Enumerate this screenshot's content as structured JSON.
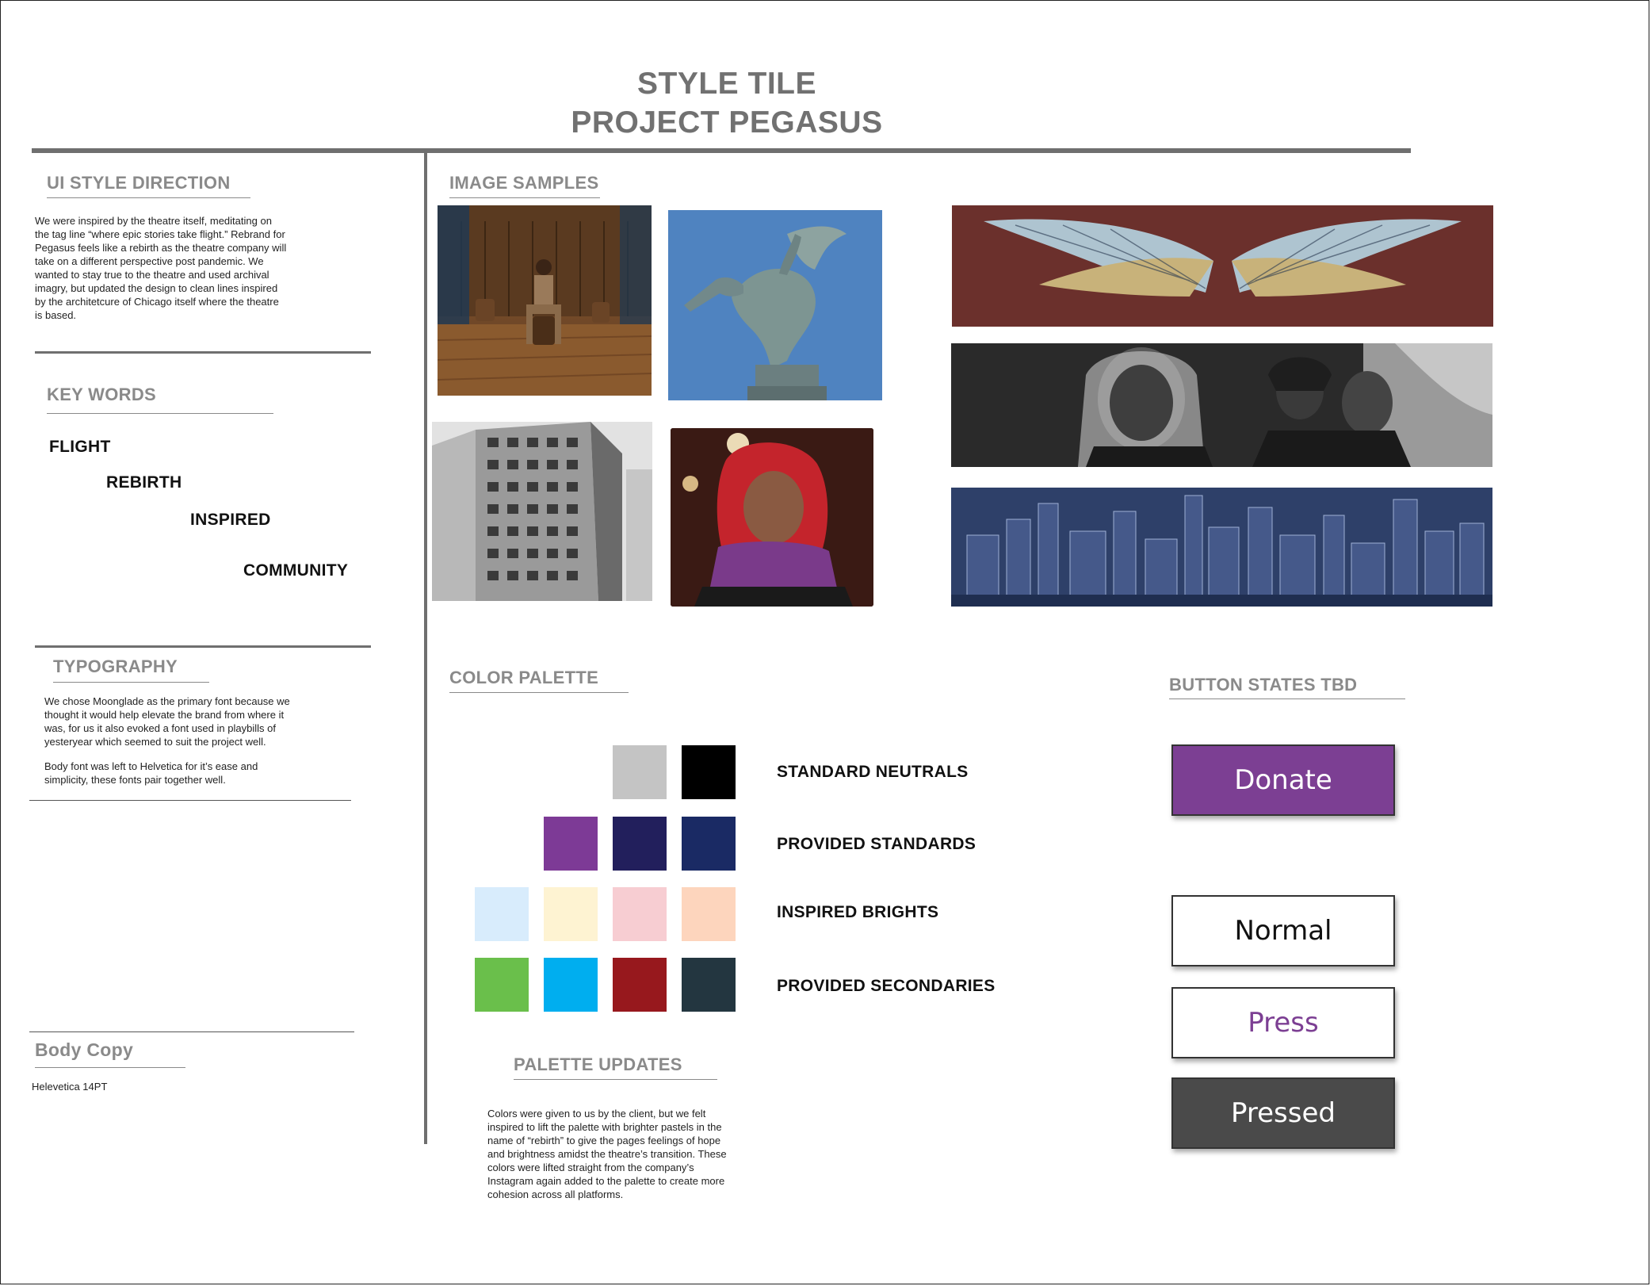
{
  "header": {
    "title_line1": "STYLE TILE",
    "title_line2": "PROJECT PEGASUS"
  },
  "ui_style_direction": {
    "heading": "UI STYLE DIRECTION",
    "lines": [
      "We were inspired by the theatre itself, meditating on",
      "the tag line “where epic stories take flight.” Rebrand for",
      "Pegasus feels like a rebirth as the theatre company will",
      "take on a different perspective post pandemic. We",
      "wanted to stay true to the theatre and used archival",
      "imagry, but updated the design to clean lines inspired",
      "by the architetcure of Chicago itself where the theatre",
      "is based."
    ]
  },
  "key_words": {
    "heading": "KEY WORDS",
    "words": [
      "FLIGHT",
      "REBIRTH",
      "INSPIRED",
      "COMMUNITY"
    ]
  },
  "typography": {
    "heading": "TYPOGRAPHY",
    "para1": [
      "We chose Moonglade as the primary font because we",
      "thought it would help elevate the brand from where it",
      "was, for us it also evoked a font used in playbills of",
      "yesteryear which seemed to suit the project well."
    ],
    "para2": [
      "Body font was left to Helvetica for it’s ease and",
      "simplicity, these fonts pair together well."
    ]
  },
  "body_copy": {
    "heading": "Body Copy",
    "sample": "Helevetica 14PT"
  },
  "image_samples": {
    "heading": "IMAGE SAMPLES"
  },
  "color_palette": {
    "heading": "COLOR PALETTE",
    "rows": [
      {
        "label": "STANDARD NEUTRALS",
        "colors": [
          "#c4c4c4",
          "#000000"
        ]
      },
      {
        "label": "PROVIDED STANDARDS",
        "colors": [
          "#7d3a96",
          "#221f5c",
          "#1a2a64"
        ]
      },
      {
        "label": "INSPIRED BRIGHTS",
        "colors": [
          "#d8ecfc",
          "#fef3d2",
          "#f7cdd2",
          "#fdd5bd"
        ]
      },
      {
        "label": "PROVIDED SECONDARIES",
        "colors": [
          "#6abf4b",
          "#00aeef",
          "#97181d",
          "#233640"
        ]
      }
    ]
  },
  "palette_updates": {
    "heading": "PALETTE UPDATES",
    "lines": [
      "Colors were given to us by the client, but we felt",
      "inspired to lift the palette with brighter pastels in the",
      "name of “rebirth” to give the pages feelings of hope",
      "and brightness amidst the theatre’s transition. These",
      "colors were lifted straight from the company’s",
      "Instagram again added to the palette to create more",
      "cohesion across all platforms."
    ]
  },
  "buttons": {
    "heading": "BUTTON STATES TBD",
    "donate": "Donate",
    "normal": "Normal",
    "press": "Press",
    "pressed": "Pressed",
    "colors": {
      "donate_bg": "#7c3f93",
      "press_text": "#7c3f93",
      "pressed_bg": "#4a4a4a"
    }
  }
}
